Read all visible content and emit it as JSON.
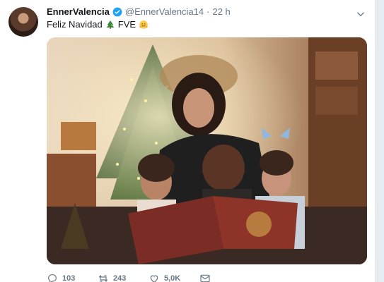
{
  "tweet": {
    "author_name": "EnnerValencia",
    "handle": "@EnnerValencia14",
    "separator": "·",
    "time": "22 h",
    "text": "Feliz Navidad",
    "tag": "FVE",
    "verified": true
  },
  "actions": {
    "reply_count": "103",
    "retweet_count": "243",
    "like_count": "5,0K"
  },
  "colors": {
    "accent": "#1da1f2",
    "text_secondary": "#657786"
  },
  "icons": [
    "verified-badge-icon",
    "chevron-down-icon",
    "christmas-tree-icon",
    "hugging-face-icon",
    "reply-icon",
    "retweet-icon",
    "like-icon",
    "message-icon"
  ]
}
